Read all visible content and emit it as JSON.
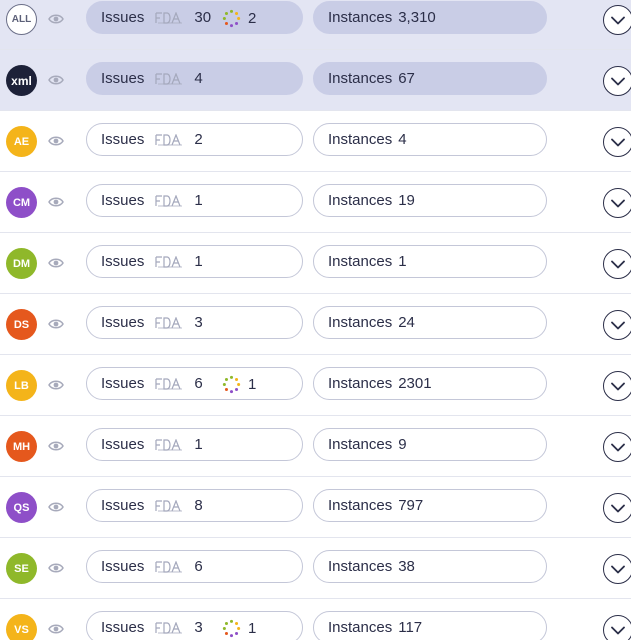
{
  "labels": {
    "issues": "Issues",
    "instances": "Instances"
  },
  "colors": {
    "selected_row": "#e3e5f3",
    "selected_pill": "#c9cde6",
    "pill_border": "#c4c7d8",
    "text": "#2b2e48"
  },
  "icons": {
    "visibility": "eye-icon",
    "source": "fda-logo-icon",
    "in_progress": "spinner-icon",
    "expand": "chevron-down-icon"
  },
  "rows": [
    {
      "code": "ALL",
      "badge_color": "#ffffff",
      "issues": "30",
      "spinner_count": "2",
      "instances": "3,310",
      "selected": true
    },
    {
      "code": "xml",
      "badge_color": "#1d2138",
      "issues": "4",
      "spinner_count": null,
      "instances": "67",
      "selected": true
    },
    {
      "code": "AE",
      "badge_color": "#f4b41a",
      "issues": "2",
      "spinner_count": null,
      "instances": "4",
      "selected": false
    },
    {
      "code": "CM",
      "badge_color": "#8e4fc8",
      "issues": "1",
      "spinner_count": null,
      "instances": "19",
      "selected": false
    },
    {
      "code": "DM",
      "badge_color": "#8fb82a",
      "issues": "1",
      "spinner_count": null,
      "instances": "1",
      "selected": false
    },
    {
      "code": "DS",
      "badge_color": "#e5581d",
      "issues": "3",
      "spinner_count": null,
      "instances": "24",
      "selected": false
    },
    {
      "code": "LB",
      "badge_color": "#f4b41a",
      "issues": "6",
      "spinner_count": "1",
      "instances": "2301",
      "selected": false
    },
    {
      "code": "MH",
      "badge_color": "#e5581d",
      "issues": "1",
      "spinner_count": null,
      "instances": "9",
      "selected": false
    },
    {
      "code": "QS",
      "badge_color": "#8e4fc8",
      "issues": "8",
      "spinner_count": null,
      "instances": "797",
      "selected": false
    },
    {
      "code": "SE",
      "badge_color": "#8fb82a",
      "issues": "6",
      "spinner_count": null,
      "instances": "38",
      "selected": false
    },
    {
      "code": "VS",
      "badge_color": "#f4b41a",
      "issues": "3",
      "spinner_count": "1",
      "instances": "117",
      "selected": false
    }
  ]
}
